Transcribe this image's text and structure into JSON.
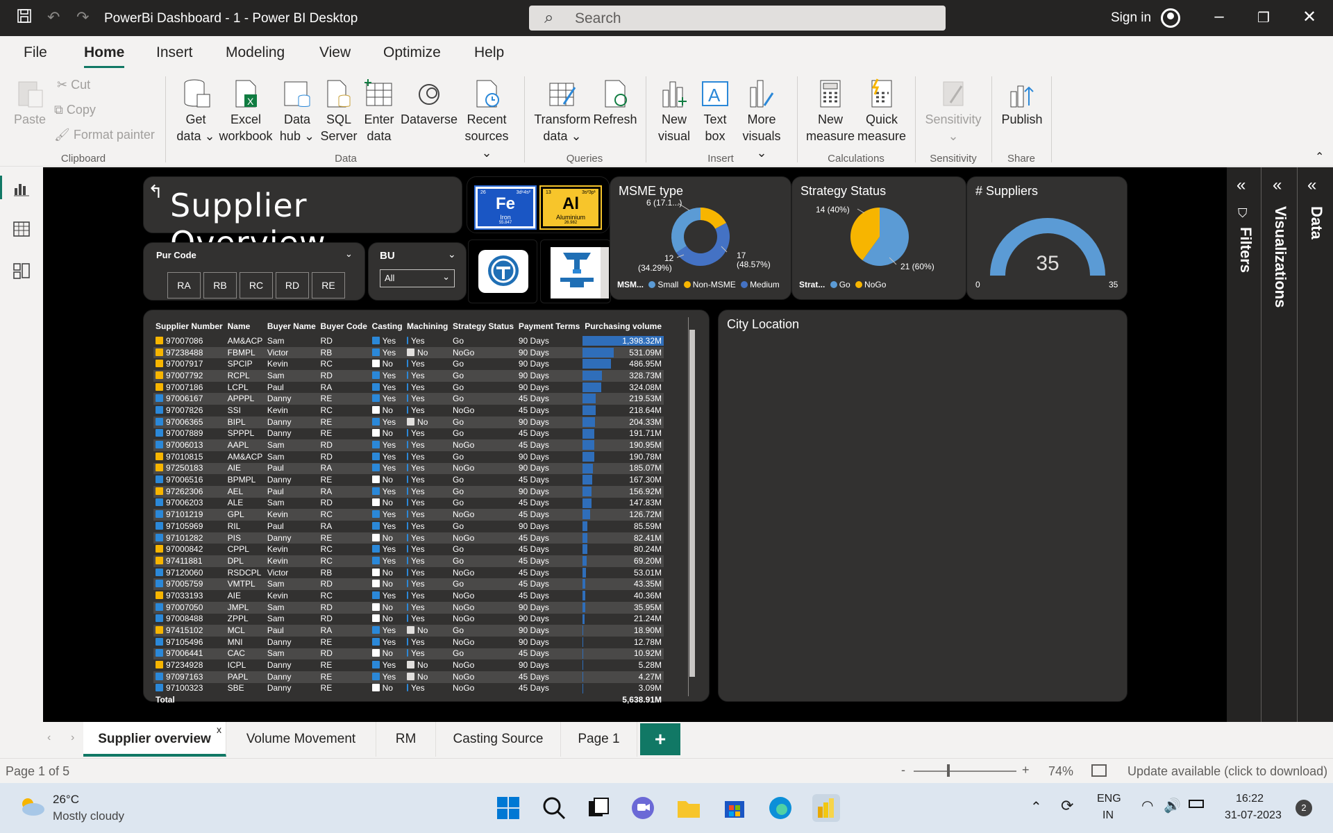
{
  "window": {
    "title": "PowerBi Dashboard - 1 - Power BI Desktop",
    "search_placeholder": "Search",
    "signin": "Sign in"
  },
  "menu": [
    "File",
    "Home",
    "Insert",
    "Modeling",
    "View",
    "Optimize",
    "Help"
  ],
  "ribbon": {
    "clipboard": {
      "paste": "Paste",
      "cut": "Cut",
      "copy": "Copy",
      "format_painter": "Format painter",
      "group": "Clipboard"
    },
    "data": {
      "get_data": [
        "Get",
        "data"
      ],
      "excel": [
        "Excel",
        "workbook"
      ],
      "data_hub": [
        "Data",
        "hub"
      ],
      "sql": [
        "SQL",
        "Server"
      ],
      "enter": [
        "Enter",
        "data"
      ],
      "dataverse": "Dataverse",
      "recent": [
        "Recent",
        "sources"
      ],
      "group": "Data"
    },
    "queries": {
      "transform": [
        "Transform",
        "data"
      ],
      "refresh": "Refresh",
      "group": "Queries"
    },
    "insert": {
      "new_visual": [
        "New",
        "visual"
      ],
      "text_box": [
        "Text",
        "box"
      ],
      "more_visuals": [
        "More",
        "visuals"
      ],
      "group": "Insert"
    },
    "calculations": {
      "new_measure": [
        "New",
        "measure"
      ],
      "quick_measure": [
        "Quick",
        "measure"
      ],
      "group": "Calculations"
    },
    "sensitivity": {
      "label": "Sensitivity",
      "group": "Sensitivity"
    },
    "share": {
      "publish": "Publish",
      "group": "Share"
    }
  },
  "report": {
    "title": "Supplier Overview",
    "elements": [
      {
        "num": "26",
        "config": "3d⁶4s²",
        "symbol": "Fe",
        "name": "Iron",
        "mass": "55.847"
      },
      {
        "num": "13",
        "config": "3s²3p¹",
        "symbol": "Al",
        "name": "Aluminium",
        "mass": "26.982"
      }
    ],
    "pur_code": {
      "label": "Pur Code",
      "options": [
        "RA",
        "RB",
        "RC",
        "RD",
        "RE"
      ]
    },
    "bu": {
      "label": "BU",
      "value": "All"
    },
    "msme": {
      "title": "MSME type",
      "legend_title": "MSM...",
      "labels": {
        "top": "6 (17.1...)",
        "left": [
          "12",
          "(34.29%)"
        ],
        "right": [
          "17",
          "(48.57%)"
        ]
      },
      "legend": [
        {
          "name": "Small",
          "color": "#5b9bd5"
        },
        {
          "name": "Non-MSME",
          "color": "#f7b500"
        },
        {
          "name": "Medium",
          "color": "#4472c4"
        }
      ],
      "values": [
        {
          "name": "Small",
          "value": 12,
          "pct": 34.29
        },
        {
          "name": "Non-MSME",
          "value": 6,
          "pct": 17.14
        },
        {
          "name": "Medium",
          "value": 17,
          "pct": 48.57
        }
      ]
    },
    "strategy": {
      "title": "Strategy Status",
      "legend_title": "Strat...",
      "labels": {
        "top": "14 (40%)",
        "right": "21 (60%)"
      },
      "legend": [
        {
          "name": "Go",
          "color": "#5b9bd5"
        },
        {
          "name": "NoGo",
          "color": "#f7b500"
        }
      ],
      "values": [
        {
          "name": "Go",
          "value": 21,
          "pct": 60
        },
        {
          "name": "NoGo",
          "value": 14,
          "pct": 40
        }
      ]
    },
    "suppliers": {
      "title": "# Suppliers",
      "value": "35",
      "min": "0",
      "max": "35",
      "fraction": 1
    },
    "city": {
      "title": "City Location"
    },
    "table": {
      "columns": [
        "Supplier Number",
        "Name",
        "Buyer Name",
        "Buyer Code",
        "Casting",
        "Machining",
        "Strategy Status",
        "Payment Terms",
        "Purchasing volume"
      ],
      "max_volume": 1398.32,
      "rows": [
        [
          "97007086",
          "AM&ACP",
          "Sam",
          "RD",
          "Yes",
          "Yes",
          "Go",
          "90 Days",
          "1,398.32M",
          1398.32,
          "gold"
        ],
        [
          "97238488",
          "FBMPL",
          "Victor",
          "RB",
          "Yes",
          "No",
          "NoGo",
          "90 Days",
          "531.09M",
          531.09,
          "gold"
        ],
        [
          "97007917",
          "SPCIP",
          "Kevin",
          "RC",
          "No",
          "Yes",
          "Go",
          "90 Days",
          "486.95M",
          486.95,
          "gold"
        ],
        [
          "97007792",
          "RCPL",
          "Sam",
          "RD",
          "Yes",
          "Yes",
          "Go",
          "90 Days",
          "328.73M",
          328.73,
          "gold"
        ],
        [
          "97007186",
          "LCPL",
          "Paul",
          "RA",
          "Yes",
          "Yes",
          "Go",
          "90 Days",
          "324.08M",
          324.08,
          "gold"
        ],
        [
          "97006167",
          "APPPL",
          "Danny",
          "RE",
          "Yes",
          "Yes",
          "Go",
          "45 Days",
          "219.53M",
          219.53,
          "blue"
        ],
        [
          "97007826",
          "SSI",
          "Kevin",
          "RC",
          "No",
          "Yes",
          "NoGo",
          "45 Days",
          "218.64M",
          218.64,
          "blue"
        ],
        [
          "97006365",
          "BIPL",
          "Danny",
          "RE",
          "Yes",
          "No",
          "Go",
          "90 Days",
          "204.33M",
          204.33,
          "blue"
        ],
        [
          "97007889",
          "SPPPL",
          "Danny",
          "RE",
          "No",
          "Yes",
          "Go",
          "45 Days",
          "191.71M",
          191.71,
          "blue"
        ],
        [
          "97006013",
          "AAPL",
          "Sam",
          "RD",
          "Yes",
          "Yes",
          "NoGo",
          "45 Days",
          "190.95M",
          190.95,
          "blue"
        ],
        [
          "97010815",
          "AM&ACP",
          "Sam",
          "RD",
          "Yes",
          "Yes",
          "Go",
          "90 Days",
          "190.78M",
          190.78,
          "gold"
        ],
        [
          "97250183",
          "AIE",
          "Paul",
          "RA",
          "Yes",
          "Yes",
          "NoGo",
          "90 Days",
          "185.07M",
          185.07,
          "gold"
        ],
        [
          "97006516",
          "BPMPL",
          "Danny",
          "RE",
          "No",
          "Yes",
          "Go",
          "45 Days",
          "167.30M",
          167.3,
          "blue"
        ],
        [
          "97262306",
          "AEL",
          "Paul",
          "RA",
          "Yes",
          "Yes",
          "Go",
          "90 Days",
          "156.92M",
          156.92,
          "gold"
        ],
        [
          "97006203",
          "ALE",
          "Sam",
          "RD",
          "No",
          "Yes",
          "Go",
          "45 Days",
          "147.83M",
          147.83,
          "blue"
        ],
        [
          "97101219",
          "GPL",
          "Kevin",
          "RC",
          "Yes",
          "Yes",
          "NoGo",
          "45 Days",
          "126.72M",
          126.72,
          "blue"
        ],
        [
          "97105969",
          "RIL",
          "Paul",
          "RA",
          "Yes",
          "Yes",
          "Go",
          "90 Days",
          "85.59M",
          85.59,
          "blue"
        ],
        [
          "97101282",
          "PIS",
          "Danny",
          "RE",
          "No",
          "Yes",
          "NoGo",
          "45 Days",
          "82.41M",
          82.41,
          "blue"
        ],
        [
          "97000842",
          "CPPL",
          "Kevin",
          "RC",
          "Yes",
          "Yes",
          "Go",
          "45 Days",
          "80.24M",
          80.24,
          "gold"
        ],
        [
          "97411881",
          "DPL",
          "Kevin",
          "RC",
          "Yes",
          "Yes",
          "Go",
          "45 Days",
          "69.20M",
          69.2,
          "gold"
        ],
        [
          "97120060",
          "RSDCPL",
          "Victor",
          "RB",
          "No",
          "Yes",
          "NoGo",
          "45 Days",
          "53.01M",
          53.01,
          "blue"
        ],
        [
          "97005759",
          "VMTPL",
          "Sam",
          "RD",
          "No",
          "Yes",
          "Go",
          "45 Days",
          "43.35M",
          43.35,
          "blue"
        ],
        [
          "97033193",
          "AIE",
          "Kevin",
          "RC",
          "Yes",
          "Yes",
          "NoGo",
          "45 Days",
          "40.36M",
          40.36,
          "gold"
        ],
        [
          "97007050",
          "JMPL",
          "Sam",
          "RD",
          "No",
          "Yes",
          "NoGo",
          "90 Days",
          "35.95M",
          35.95,
          "blue"
        ],
        [
          "97008488",
          "ZPPL",
          "Sam",
          "RD",
          "No",
          "Yes",
          "NoGo",
          "90 Days",
          "21.24M",
          21.24,
          "blue"
        ],
        [
          "97415102",
          "MCL",
          "Paul",
          "RA",
          "Yes",
          "No",
          "Go",
          "90 Days",
          "18.90M",
          18.9,
          "gold"
        ],
        [
          "97105496",
          "MNI",
          "Danny",
          "RE",
          "Yes",
          "Yes",
          "NoGo",
          "90 Days",
          "12.78M",
          12.78,
          "blue"
        ],
        [
          "97006441",
          "CAC",
          "Sam",
          "RD",
          "No",
          "Yes",
          "Go",
          "45 Days",
          "10.92M",
          10.92,
          "blue"
        ],
        [
          "97234928",
          "ICPL",
          "Danny",
          "RE",
          "Yes",
          "No",
          "NoGo",
          "90 Days",
          "5.28M",
          5.28,
          "gold"
        ],
        [
          "97097163",
          "PAPL",
          "Danny",
          "RE",
          "Yes",
          "No",
          "NoGo",
          "45 Days",
          "4.27M",
          4.27,
          "blue"
        ],
        [
          "97100323",
          "SBE",
          "Danny",
          "RE",
          "No",
          "Yes",
          "NoGo",
          "45 Days",
          "3.09M",
          3.09,
          "blue"
        ]
      ],
      "total_label": "Total",
      "total_value": "5,638.91M"
    }
  },
  "side_panels": [
    "Filters",
    "Visualizations",
    "Data"
  ],
  "tabs": [
    "Supplier overview",
    "Volume Movement",
    "RM",
    "Casting Source",
    "Page 1"
  ],
  "status": {
    "page": "Page 1 of 5",
    "zoom": "74%",
    "update": "Update available (click to download)",
    "zoom_minus": "-",
    "zoom_plus": "+"
  },
  "taskbar": {
    "temp": "26°C",
    "weather": "Mostly cloudy",
    "lang1": "ENG",
    "lang2": "IN",
    "time": "16:22",
    "date": "31-07-2023",
    "notif": "2"
  },
  "colors": {
    "accent": "#117865",
    "blue": "#5b9bd5",
    "gold": "#f7b500",
    "dark": "#4472c4",
    "bar": "#2f6eba"
  }
}
